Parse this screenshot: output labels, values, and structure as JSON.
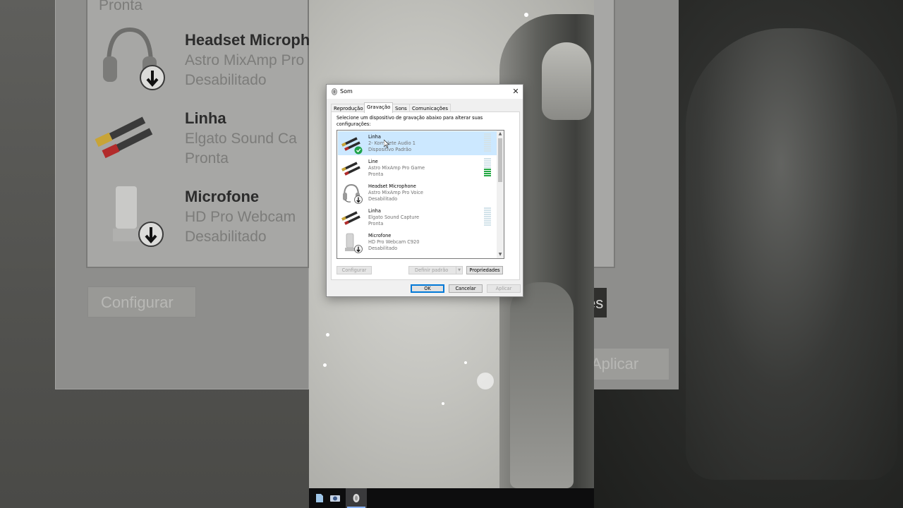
{
  "background_left": {
    "rows": [
      {
        "name": "Headset Microph",
        "desc": "Astro MixAmp Pro",
        "status": "Desabilitado"
      },
      {
        "name": "Linha",
        "desc": "Elgato Sound Ca",
        "status": "Pronta"
      },
      {
        "name": "Microfone",
        "desc": "HD Pro Webcam",
        "status": "Desabilitado"
      }
    ],
    "top_fragment": "Pronta",
    "button": "Configurar"
  },
  "background_right": {
    "button_fragment": "es",
    "apply_fragment": "Aplicar"
  },
  "dialog": {
    "title": "Som",
    "close_glyph": "✕",
    "tabs": [
      "Reprodução",
      "Gravação",
      "Sons",
      "Comunicações"
    ],
    "selected_tab": "Gravação",
    "instruction": "Selecione um dispositivo de gravação abaixo para alterar suas configurações:",
    "devices": [
      {
        "name": "Linha",
        "desc": "2- Komplete Audio 1",
        "status": "Dispositivo Padrão",
        "icon": "rca-cable-icon",
        "default": true,
        "selected": true,
        "meter_level": 0
      },
      {
        "name": "Line",
        "desc": "Astro MixAmp Pro Game",
        "status": "Pronta",
        "icon": "rca-cable-icon",
        "default": false,
        "selected": false,
        "meter_level": 0.4
      },
      {
        "name": "Headset Microphone",
        "desc": "Astro MixAmp Pro Voice",
        "status": "Desabilitado",
        "icon": "headset-icon",
        "default": false,
        "selected": false,
        "meter_level": null
      },
      {
        "name": "Linha",
        "desc": "Elgato Sound Capture",
        "status": "Pronta",
        "icon": "rca-cable-icon",
        "default": false,
        "selected": false,
        "meter_level": 0
      },
      {
        "name": "Microfone",
        "desc": "HD Pro Webcam C920",
        "status": "Desabilitado",
        "icon": "webcam-mic-icon",
        "default": false,
        "selected": false,
        "meter_level": null
      }
    ],
    "buttons": {
      "configure": "Configurar",
      "set_default": "Definir padrão",
      "properties": "Propriedades",
      "ok": "OK",
      "cancel": "Cancelar",
      "apply": "Aplicar"
    }
  },
  "taskbar": {
    "items": [
      "file-icon",
      "camera-icon",
      "sound-icon"
    ]
  },
  "colors": {
    "selection": "#cce8ff",
    "meter_on": "#23a843",
    "accent": "#0078d7"
  }
}
